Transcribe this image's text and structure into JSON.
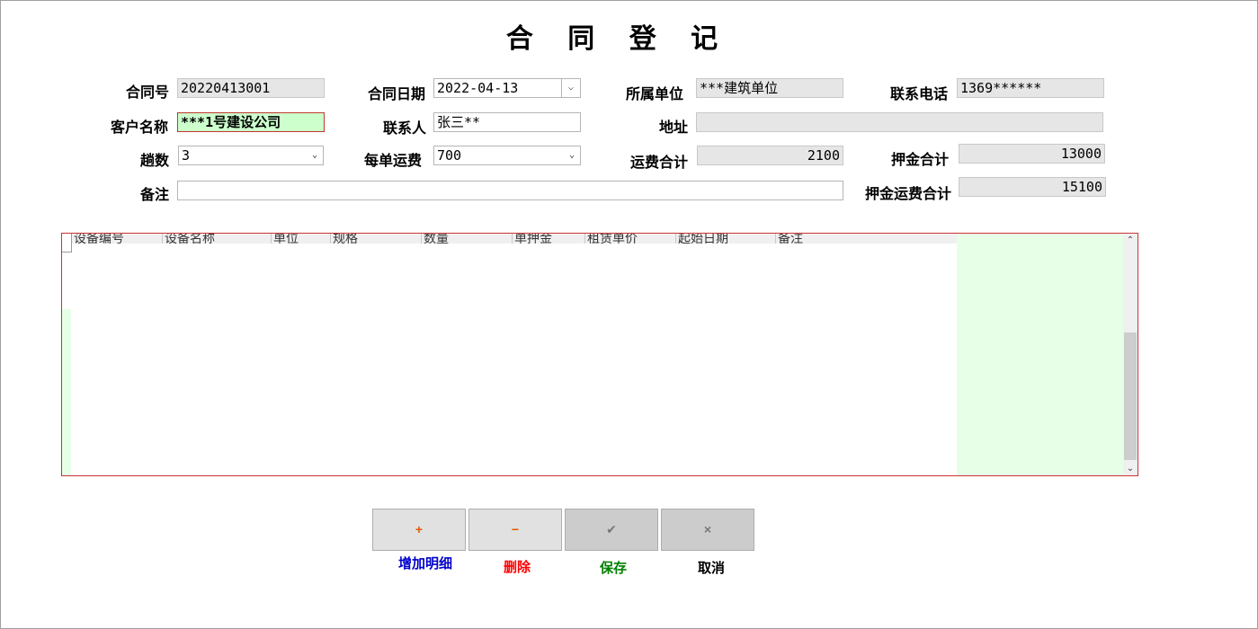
{
  "window": {
    "title": "合 同 登 记"
  },
  "form": {
    "contract_no": {
      "label": "合同号",
      "value": "20220413001"
    },
    "contract_date": {
      "label": "合同日期",
      "value": "2022-04-13"
    },
    "unit": {
      "label": "所属单位",
      "value": "***建筑单位"
    },
    "phone": {
      "label": "联系电话",
      "value": "1369******"
    },
    "customer": {
      "label": "客户名称",
      "value": "***1号建设公司"
    },
    "contact": {
      "label": "联系人",
      "value": "张三**"
    },
    "address": {
      "label": "地址",
      "value": ""
    },
    "trips": {
      "label": "趟数",
      "value": "3"
    },
    "freight_each": {
      "label": "每单运费",
      "value": "700"
    },
    "freight_total": {
      "label": "运费合计",
      "value": "2100"
    },
    "deposit_total": {
      "label": "押金合计",
      "value": "13000"
    },
    "remark": {
      "label": "备注",
      "value": ""
    },
    "deposit_freight_total": {
      "label": "押金运费合计",
      "value": "15100"
    }
  },
  "grid": {
    "columns": [
      "设备编号",
      "设备名称",
      "单位",
      "规格",
      "数量",
      "单押金",
      "租赁单价",
      "起始日期",
      "备注"
    ]
  },
  "buttons": {
    "add": {
      "icon": "+",
      "label": "增加明细",
      "color": "#0000cc"
    },
    "delete": {
      "icon": "−",
      "label": "删除",
      "color": "#ff0000"
    },
    "save": {
      "icon": "✔",
      "label": "保存",
      "color": "#008000"
    },
    "cancel": {
      "icon": "×",
      "label": "取消",
      "color": "#000000"
    }
  },
  "icons": {
    "dropdown": "chevron-down-icon",
    "scroll_up": "chevron-up-icon",
    "scroll_down": "chevron-down-icon"
  }
}
